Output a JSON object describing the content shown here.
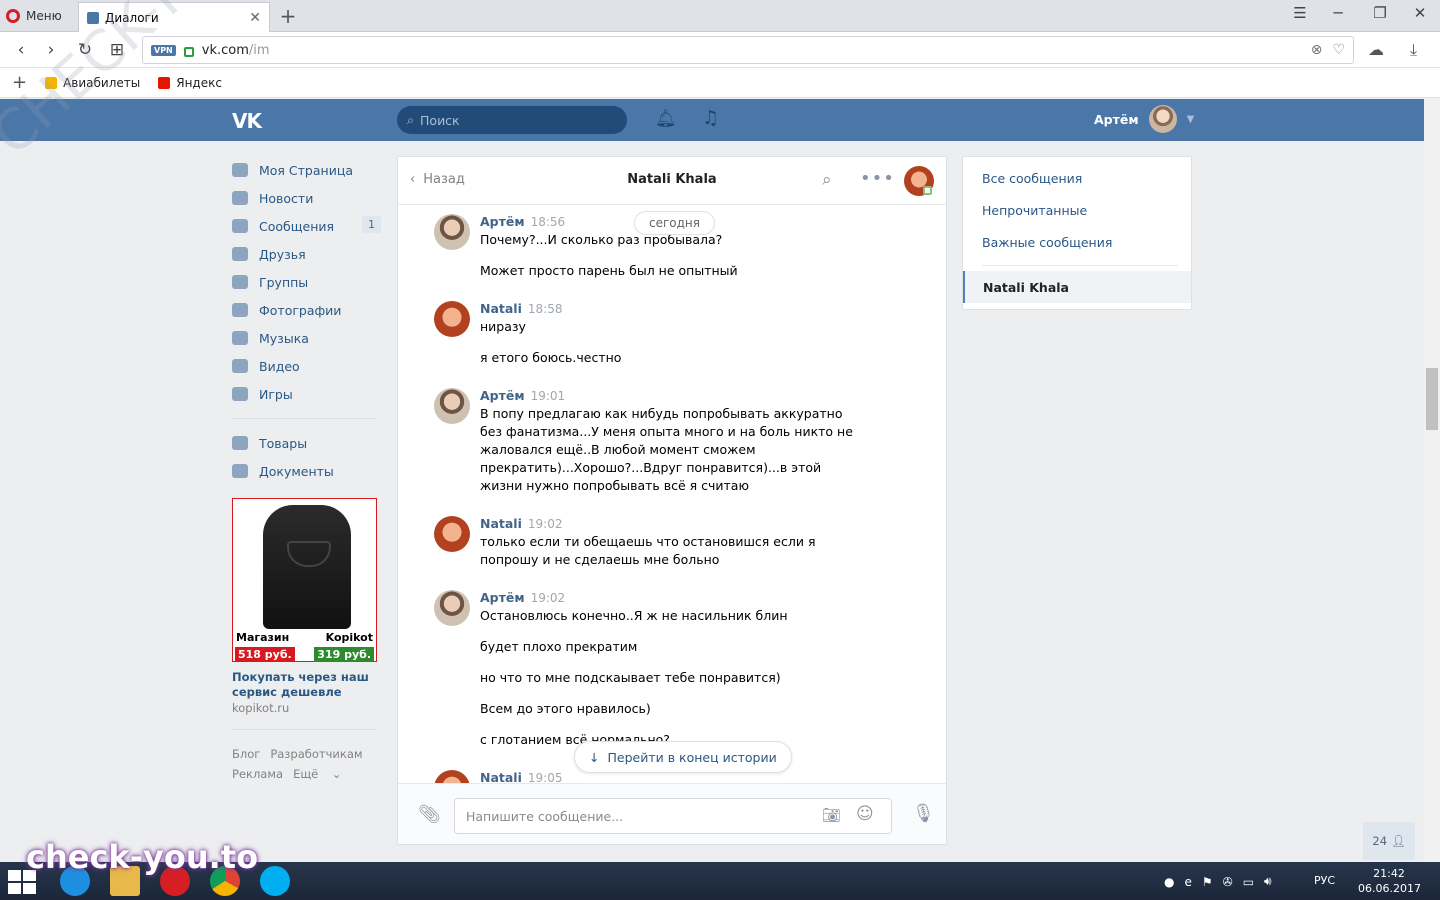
{
  "browser": {
    "menu_label": "Меню",
    "tab_title": "Диалоги",
    "url_host": "vk.com",
    "url_path": "/im",
    "vpn_label": "VPN",
    "bookmarks": [
      {
        "label": "Авиабилеты",
        "color": "#f2b400"
      },
      {
        "label": "Яндекс",
        "color": "#e61400"
      }
    ]
  },
  "vk": {
    "logo": "VK",
    "search_placeholder": "Поиск",
    "user_name": "Артём",
    "nav": [
      {
        "label": "Моя Страница",
        "icon": "home-icon"
      },
      {
        "label": "Новости",
        "icon": "news-icon"
      },
      {
        "label": "Сообщения",
        "icon": "messages-icon",
        "count": "1"
      },
      {
        "label": "Друзья",
        "icon": "friends-icon"
      },
      {
        "label": "Группы",
        "icon": "groups-icon"
      },
      {
        "label": "Фотографии",
        "icon": "camera-icon"
      },
      {
        "label": "Музыка",
        "icon": "music-icon"
      },
      {
        "label": "Видео",
        "icon": "video-icon"
      },
      {
        "label": "Игры",
        "icon": "gamepad-icon"
      },
      {
        "label": "Товары",
        "icon": "bag-icon"
      },
      {
        "label": "Документы",
        "icon": "document-icon"
      }
    ],
    "ad": {
      "shop": "Магазин",
      "brand": "Kopikot",
      "price_old": "518 руб.",
      "price_new": "319 руб.",
      "title": "Покупать через наш сервис дешевле",
      "domain": "kopikot.ru"
    },
    "footer": {
      "blog": "Блог",
      "developers": "Разработчикам",
      "ads": "Реклама",
      "more": "Ещё"
    }
  },
  "chat": {
    "back_label": "Назад",
    "title": "Natali Khala",
    "today_badge": "сегодня",
    "goto_end": "Перейти в конец истории",
    "composer_placeholder": "Напишите сообщение...",
    "messages": [
      {
        "author": "Артём",
        "time": "18:56",
        "lines": [
          "Почему?...И сколько раз пробывала?",
          "Может просто парень был не опытный"
        ]
      },
      {
        "author": "Natali",
        "time": "18:58",
        "lines": [
          "ниразу",
          "я етого боюсь.честно"
        ]
      },
      {
        "author": "Артём",
        "time": "19:01",
        "lines": [
          "В попу предлагаю как нибудь попробывать аккуратно без фанатизма...У меня опыта много и на боль никто не жаловался ещё..В любой момент сможем прекратить)...Хорошо?...Вдруг понравится)...в этой жизни нужно попробывать всё я считаю"
        ]
      },
      {
        "author": "Natali",
        "time": "19:02",
        "lines": [
          "только если ти обещаешь что остановишся если я попрошу и не сделаешь мне больно"
        ]
      },
      {
        "author": "Артём",
        "time": "19:02",
        "lines": [
          "Остановлюсь конечно..Я ж не насильник блин",
          "будет плохо прекратим",
          "но что то мне подскаывает тебе понравится)",
          "Всем до этого нравилось)",
          "с глотанием всё нормально?"
        ]
      },
      {
        "author": "Natali",
        "time": "19:05",
        "lines": []
      }
    ]
  },
  "filters": {
    "all": "Все сообщения",
    "unread": "Непрочитанные",
    "important": "Важные сообщения",
    "active": "Natali Khala"
  },
  "online_count": "24",
  "taskbar": {
    "lang": "РУС",
    "time": "21:42",
    "date": "06.06.2017"
  },
  "watermark": "check-you.to",
  "watermark_diag": "CHECK-YOU.ME"
}
